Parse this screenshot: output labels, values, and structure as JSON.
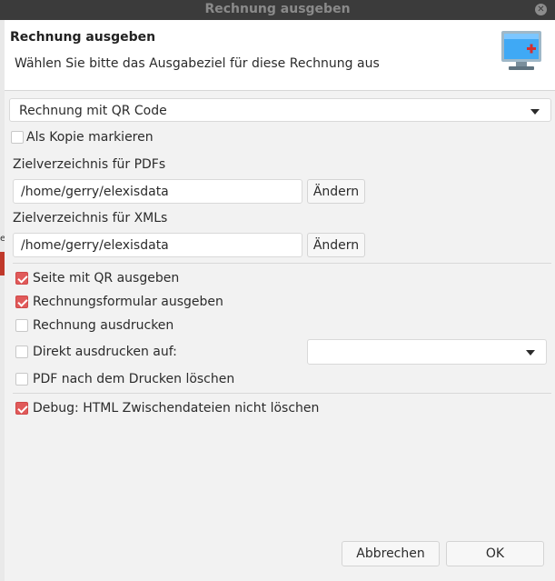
{
  "window": {
    "title": "Rechnung ausgeben"
  },
  "header": {
    "title": "Rechnung ausgeben",
    "message": "Wählen Sie bitte das Ausgabeziel für diese Rechnung aus",
    "icon": "monitor-icon"
  },
  "output_target": {
    "selected": "Rechnung mit QR Code"
  },
  "copy_checkbox": {
    "label": "Als Kopie markieren",
    "checked": false
  },
  "pdf_dir": {
    "label": "Zielverzeichnis für PDFs",
    "value": "/home/gerry/elexisdata",
    "button": "Ändern"
  },
  "xml_dir": {
    "label": "Zielverzeichnis für XMLs",
    "value": "/home/gerry/elexisdata",
    "button": "Ändern"
  },
  "options": [
    {
      "label": "Seite mit QR ausgeben",
      "checked": true
    },
    {
      "label": "Rechnungsformular ausgeben",
      "checked": true
    },
    {
      "label": "Rechnung ausdrucken",
      "checked": false
    },
    {
      "label": "Direkt ausdrucken auf:",
      "checked": false
    },
    {
      "label": "PDF nach dem Drucken löschen",
      "checked": false
    }
  ],
  "printer_select": {
    "selected": ""
  },
  "debug": {
    "label": "Debug: HTML Zwischendateien nicht löschen",
    "checked": true
  },
  "buttons": {
    "cancel": "Abbrechen",
    "ok": "OK"
  },
  "colors": {
    "check_accent": "#e05a5a",
    "titlebar": "#3b3b3b"
  }
}
